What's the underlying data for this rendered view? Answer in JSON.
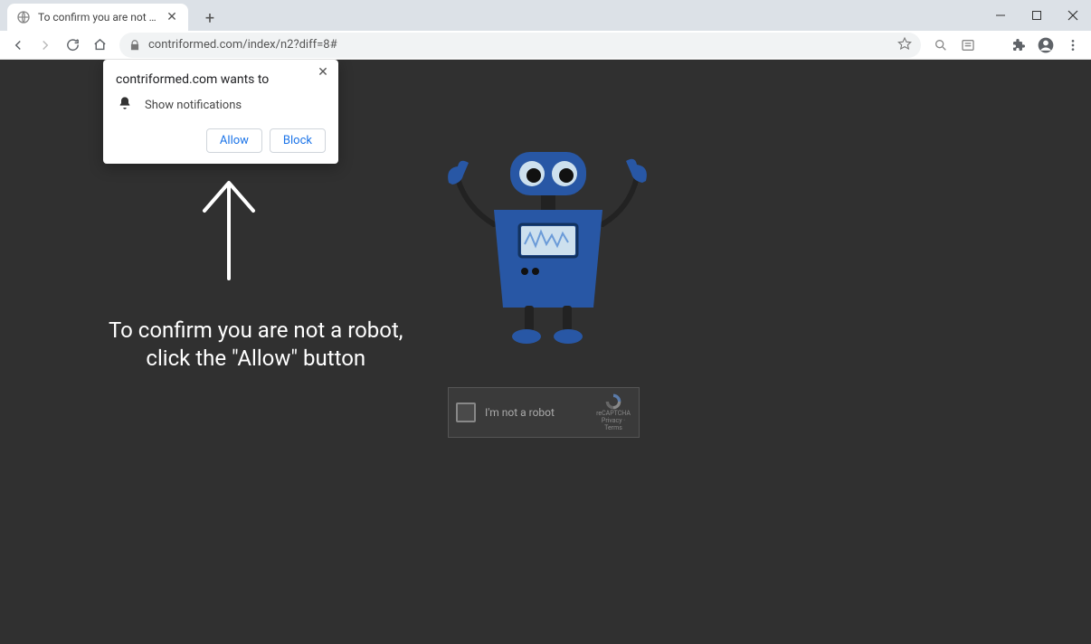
{
  "titlebar": {
    "tab_title": "To confirm you are not a robot, c"
  },
  "toolbar": {
    "url": "contriformed.com/index/n2?diff=8#"
  },
  "notification": {
    "title": "contriformed.com wants to",
    "item": "Show notifications",
    "allow_label": "Allow",
    "block_label": "Block"
  },
  "page": {
    "line1": "To confirm you are not a robot,",
    "line2": "click the \"Allow\" button"
  },
  "recaptcha": {
    "label": "I'm not a robot",
    "brand": "reCAPTCHA",
    "terms": "Privacy · Terms"
  }
}
